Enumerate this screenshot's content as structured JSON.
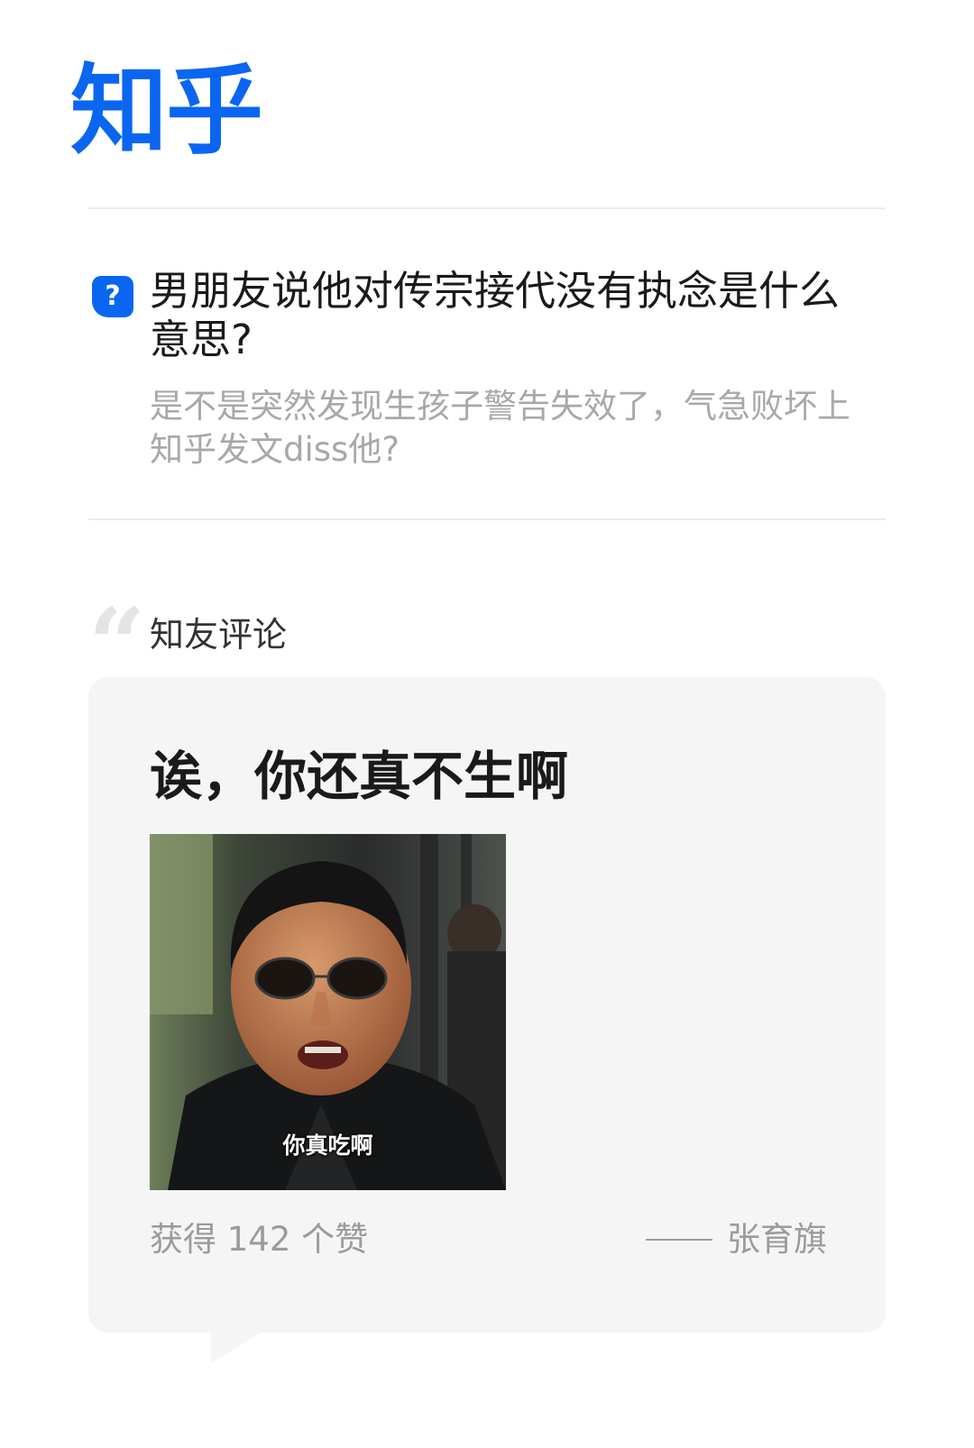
{
  "app": {
    "logo_text": "知乎",
    "brand_color": "#0a66f0"
  },
  "question": {
    "icon": "question-icon",
    "icon_glyph": "?",
    "title": "男朋友说他对传宗接代没有执念是什么意思?",
    "description": "是不是突然发现生孩子警告失效了，气急败坏上知乎发文diss他?"
  },
  "comments_section": {
    "quote_icon": "quote-icon",
    "label": "知友评论"
  },
  "comment": {
    "text": "诶，你还真不生啊",
    "image_caption": "你真吃啊",
    "likes_text": "获得 142 个赞",
    "author": "张育旗"
  }
}
